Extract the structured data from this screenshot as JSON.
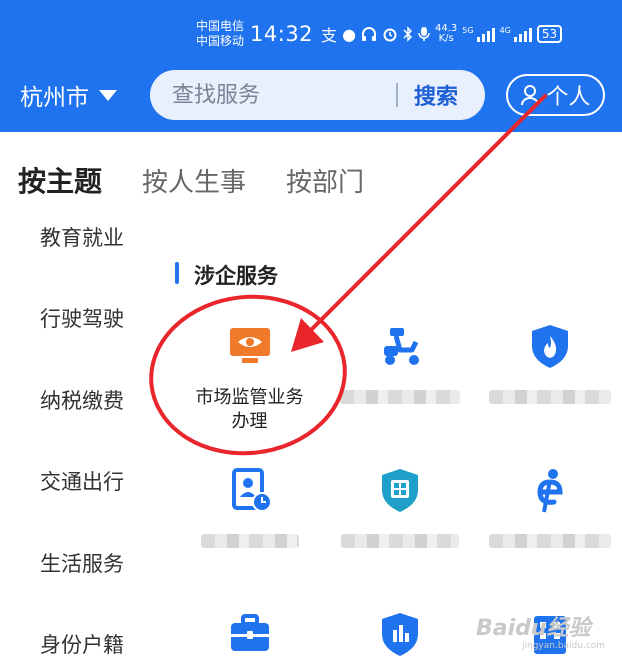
{
  "status_bar": {
    "carrier_1": "中国电信",
    "carrier_2": "中国移动",
    "time": "14:32",
    "net_speed_value": "44.3",
    "net_speed_unit": "K/s",
    "signal_1_tag": "5G",
    "signal_2_tag": "4G",
    "battery": "53"
  },
  "header": {
    "city": "杭州市",
    "search_placeholder": "查找服务",
    "search_button": "搜索",
    "personal_button": "个人"
  },
  "tabs": [
    {
      "label": "按主题",
      "active": true
    },
    {
      "label": "按人生事",
      "active": false
    },
    {
      "label": "按部门",
      "active": false
    }
  ],
  "sidebar": {
    "items": [
      "教育就业",
      "行驶驾驶",
      "纳税缴费",
      "交通出行",
      "生活服务",
      "身份户籍"
    ]
  },
  "section": {
    "title": "涉企服务",
    "services": [
      {
        "label_line1": "市场监管业务",
        "label_line2": "办理",
        "icon": "monitor-eye-icon"
      },
      {
        "label_line1": "",
        "label_line2": "",
        "icon": "scooter-icon"
      },
      {
        "label_line1": "",
        "label_line2": "",
        "icon": "fire-shield-icon"
      },
      {
        "label_line1": "",
        "label_line2": "",
        "icon": "id-card-clock-icon"
      },
      {
        "label_line1": "",
        "label_line2": "",
        "icon": "qr-shield-icon"
      },
      {
        "label_line1": "",
        "label_line2": "",
        "icon": "person-e-icon"
      },
      {
        "label_line1": "",
        "label_line2": "",
        "icon": "briefcase-icon"
      },
      {
        "label_line1": "",
        "label_line2": "",
        "icon": "shield-chart-icon"
      },
      {
        "label_line1": "",
        "label_line2": "",
        "icon": "building-icon"
      }
    ]
  },
  "watermark": {
    "text": "Baidu经验",
    "sub": "jingyan.baidu.com"
  },
  "colors": {
    "header_blue": "#1f73ee",
    "accent_orange": "#f07a2a",
    "annotation_red": "#e8262c"
  }
}
